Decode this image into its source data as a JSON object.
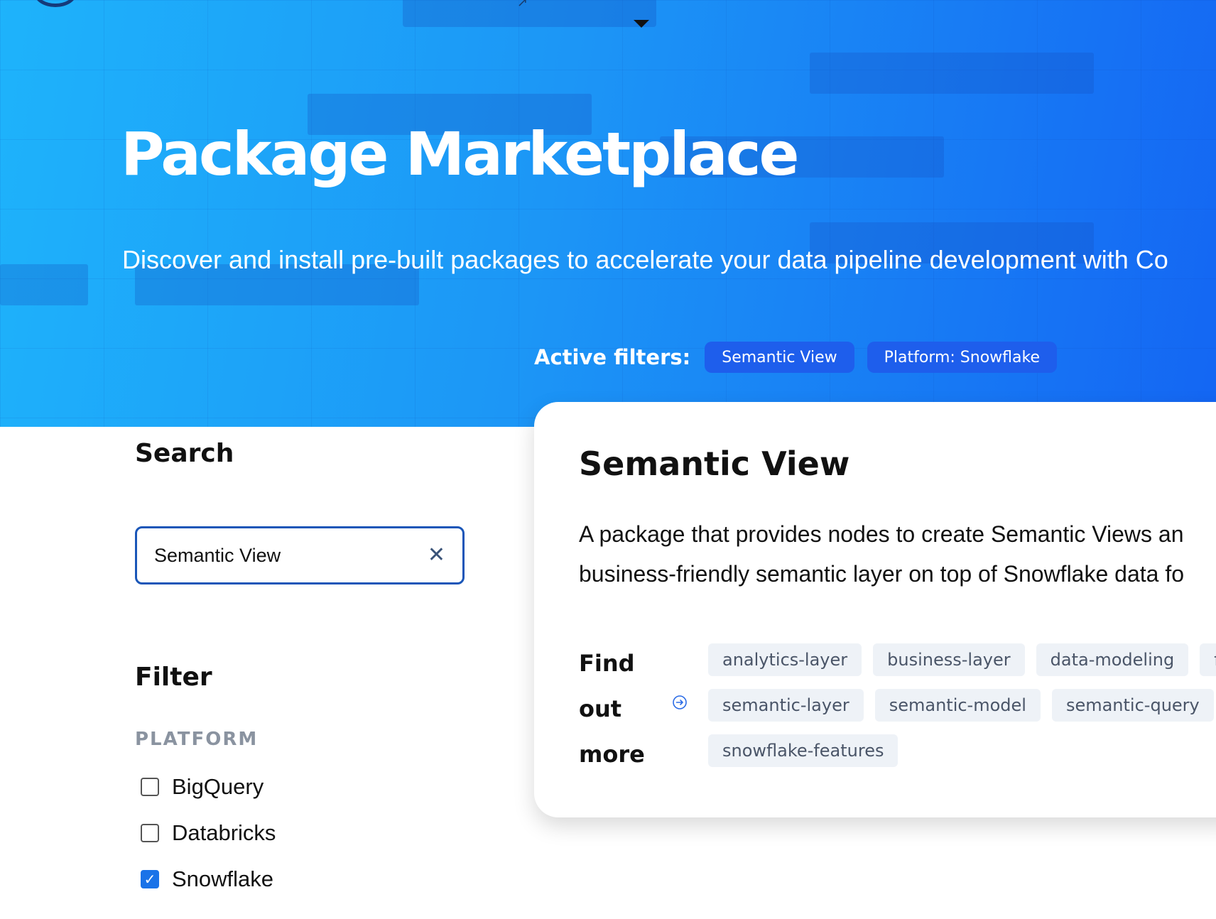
{
  "hero": {
    "title": "Package Marketplace",
    "subtitle": "Discover and install pre-built packages to accelerate your data pipeline development with Co",
    "active_filters_label": "Active filters:",
    "active_filters": [
      "Semantic View",
      "Platform: Snowflake"
    ]
  },
  "sidebar": {
    "search_title": "Search",
    "search_value": "Semantic View",
    "clear_icon": "close-icon",
    "filter_title": "Filter",
    "platform_label": "PLATFORM",
    "platforms": [
      {
        "label": "BigQuery",
        "checked": false
      },
      {
        "label": "Databricks",
        "checked": false
      },
      {
        "label": "Snowflake",
        "checked": true
      }
    ]
  },
  "card": {
    "title": "Semantic View",
    "description_line1": "A package that provides nodes to create Semantic Views an",
    "description_line2": "business-friendly semantic layer on top of Snowflake data fo",
    "find_more": [
      "Find",
      "out",
      "more"
    ],
    "tags": [
      [
        "analytics-layer",
        "business-layer",
        "data-modeling",
        "fa"
      ],
      [
        "semantic-layer",
        "semantic-model",
        "semantic-query"
      ],
      [
        "snowflake-features"
      ]
    ]
  },
  "colors": {
    "hero_start": "#1eb3fb",
    "hero_end": "#1466f3",
    "chip": "#1e5eec",
    "search_border": "#1a56b8",
    "checkbox_checked": "#1a73e8"
  }
}
